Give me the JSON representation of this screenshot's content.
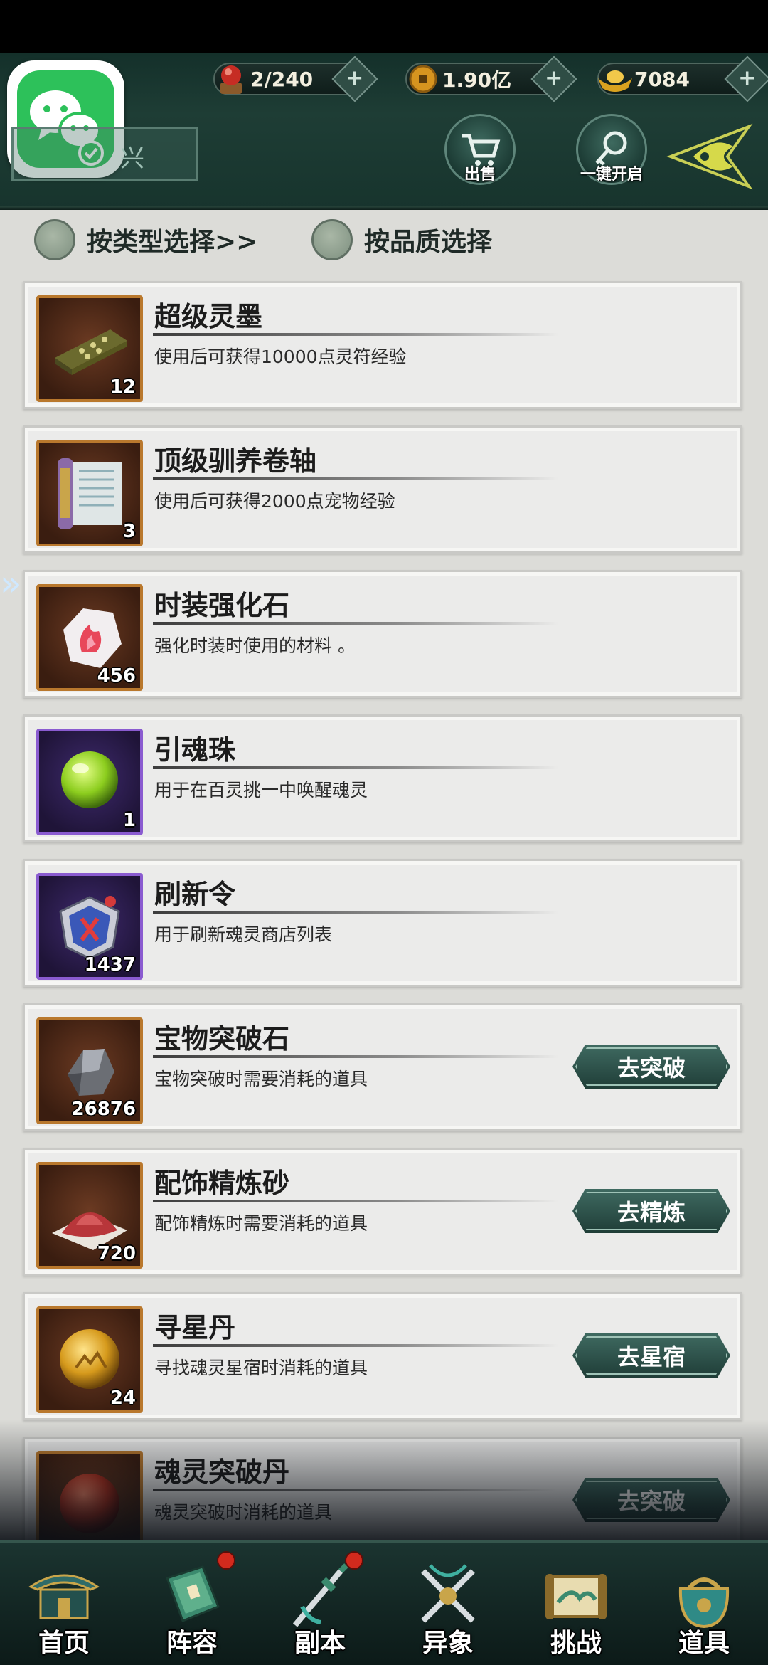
{
  "resources": [
    {
      "icon": "red-orb-icon",
      "value": "2/240"
    },
    {
      "icon": "copper-coin-icon",
      "value": "1.90亿"
    },
    {
      "icon": "gold-ingot-icon",
      "value": "7084"
    }
  ],
  "top_buttons": {
    "sell_label": "出售",
    "open_all_label": "一键开启"
  },
  "search": {
    "text": "兴"
  },
  "filters": {
    "by_type": "按类型选择>>",
    "by_quality": "按品质选择"
  },
  "items": [
    {
      "name": "超级灵墨",
      "desc": "使用后可获得10000点灵符经验",
      "count": "12",
      "icon": "ink-stick-icon",
      "frame": "orange",
      "action": ""
    },
    {
      "name": "顶级驯养卷轴",
      "desc": "使用后可获得2000点宠物经验",
      "count": "3",
      "icon": "scroll-icon",
      "frame": "orange",
      "action": ""
    },
    {
      "name": "时装强化石",
      "desc": "强化时装时使用的材料 。",
      "count": "456",
      "icon": "fire-stone-icon",
      "frame": "orange",
      "action": ""
    },
    {
      "name": "引魂珠",
      "desc": "用于在百灵挑一中唤醒魂灵",
      "count": "1",
      "icon": "green-orb-icon",
      "frame": "purple",
      "action": ""
    },
    {
      "name": "刷新令",
      "desc": "用于刷新魂灵商店列表",
      "count": "1437",
      "icon": "token-icon",
      "frame": "purple",
      "action": ""
    },
    {
      "name": "宝物突破石",
      "desc": "宝物突破时需要消耗的道具",
      "count": "26876",
      "icon": "ore-icon",
      "frame": "orange",
      "action": "去突破"
    },
    {
      "name": "配饰精炼砂",
      "desc": "配饰精炼时需要消耗的道具",
      "count": "720",
      "icon": "sand-pile-icon",
      "frame": "orange",
      "action": "去精炼"
    },
    {
      "name": "寻星丹",
      "desc": "寻找魂灵星宿时消耗的道具",
      "count": "24",
      "icon": "gold-pill-icon",
      "frame": "orange",
      "action": "去星宿"
    },
    {
      "name": "魂灵突破丹",
      "desc": "魂灵突破时消耗的道具",
      "count": "",
      "icon": "red-pill-icon",
      "frame": "orange",
      "action": "去突破"
    }
  ],
  "nav": [
    {
      "label": "首页",
      "icon": "palace-icon",
      "dot": false
    },
    {
      "label": "阵容",
      "icon": "book-icon",
      "dot": true
    },
    {
      "label": "副本",
      "icon": "sword-icon",
      "dot": true
    },
    {
      "label": "异象",
      "icon": "crossed-swords-icon",
      "dot": false
    },
    {
      "label": "挑战",
      "icon": "scroll-map-icon",
      "dot": false
    },
    {
      "label": "道具",
      "icon": "bag-icon",
      "dot": false
    }
  ],
  "colors": {
    "header_bg": "#1e3d35",
    "panel_bg": "#dcdcd8",
    "action_button": "#2f5650",
    "orange_frame": "#b9782d",
    "purple_frame": "#8a5bd0"
  }
}
